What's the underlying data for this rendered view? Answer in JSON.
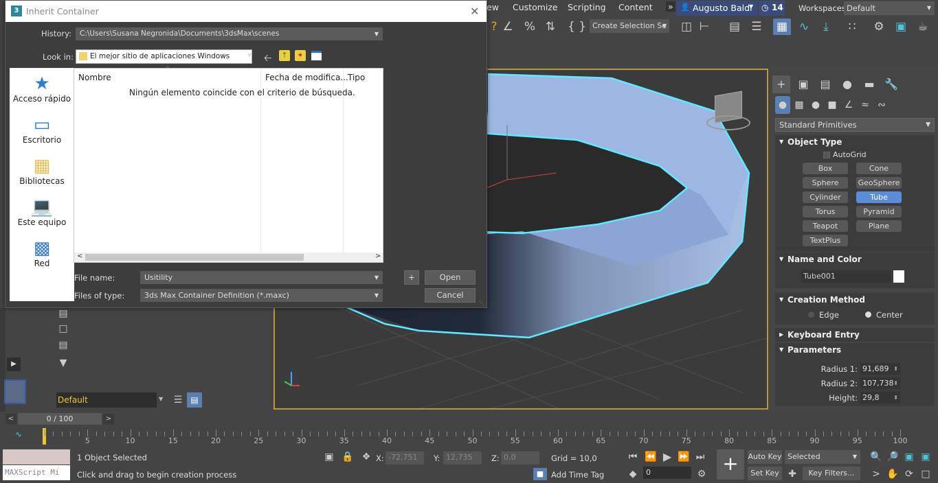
{
  "menu": {
    "items": [
      "ew",
      "Customize",
      "Scripting",
      "Content"
    ],
    "more": "»",
    "user": "Augusto Baldi",
    "badge": "14",
    "workspaces_label": "Workspaces:",
    "workspace": "Default"
  },
  "toolbar": {
    "selection_set": "Create Selection Se"
  },
  "dialog": {
    "title": "Inherit Container",
    "history_label": "History:",
    "history_value": "C:\\Users\\Susana Negronida\\Documents\\3dsMax\\scenes",
    "lookin_label": "Look in:",
    "lookin_value": "El mejor sitio de aplicaciones Windows",
    "places": [
      {
        "label": "Acceso rápido",
        "icon": "star-icon"
      },
      {
        "label": "Escritorio",
        "icon": "desktop-icon"
      },
      {
        "label": "Bibliotecas",
        "icon": "libraries-icon"
      },
      {
        "label": "Este equipo",
        "icon": "computer-icon"
      },
      {
        "label": "Red",
        "icon": "network-icon"
      }
    ],
    "columns": [
      "Nombre",
      "Fecha de modifica...",
      "Tipo"
    ],
    "empty_message": "Ningún elemento coincide con el criterio de búsqueda.",
    "filename_label": "File name:",
    "filename_value": "Usitility",
    "filetype_label": "Files of type:",
    "filetype_value": "3ds Max Container Definition (*.maxc)",
    "plus_label": "+",
    "open_label": "Open",
    "cancel_label": "Cancel"
  },
  "command_panel": {
    "category": "Standard Primitives",
    "object_type_title": "Object Type",
    "autogrid": "AutoGrid",
    "objects": [
      "Box",
      "Cone",
      "Sphere",
      "GeoSphere",
      "Cylinder",
      "Tube",
      "Torus",
      "Pyramid",
      "Teapot",
      "Plane",
      "TextPlus"
    ],
    "active_object": "Tube",
    "name_color_title": "Name and Color",
    "object_name": "Tube001",
    "creation_method_title": "Creation Method",
    "creation_options": [
      "Edge",
      "Center"
    ],
    "creation_selected": "Center",
    "keyboard_entry_title": "Keyboard Entry",
    "parameters_title": "Parameters",
    "params": [
      {
        "label": "Radius 1:",
        "value": "91,689"
      },
      {
        "label": "Radius 2:",
        "value": "107,738"
      },
      {
        "label": "Height:",
        "value": "29,8"
      }
    ]
  },
  "scene_explorer": {
    "layer": "Default"
  },
  "timeline": {
    "frame": "0 / 100",
    "ticks": [
      "5",
      "10",
      "15",
      "20",
      "25",
      "30",
      "35",
      "40",
      "45",
      "50",
      "55",
      "60",
      "65",
      "70",
      "75",
      "80",
      "85",
      "90",
      "95",
      "100"
    ]
  },
  "status": {
    "maxscript": "MAXScript Mi",
    "selected_text": "1 Object Selected",
    "prompt": "Click and drag to begin creation process",
    "x_label": "X:",
    "x_value": "-72,751",
    "y_label": "Y:",
    "y_value": "12,735",
    "z_label": "Z:",
    "z_value": "0,0",
    "grid": "Grid = 10,0",
    "add_time_tag": "Add Time Tag",
    "auto_key": "Auto Key",
    "set_key": "Set Key",
    "key_mode": "Selected",
    "key_filters": "Key Filters...",
    "frame_value": "0"
  }
}
